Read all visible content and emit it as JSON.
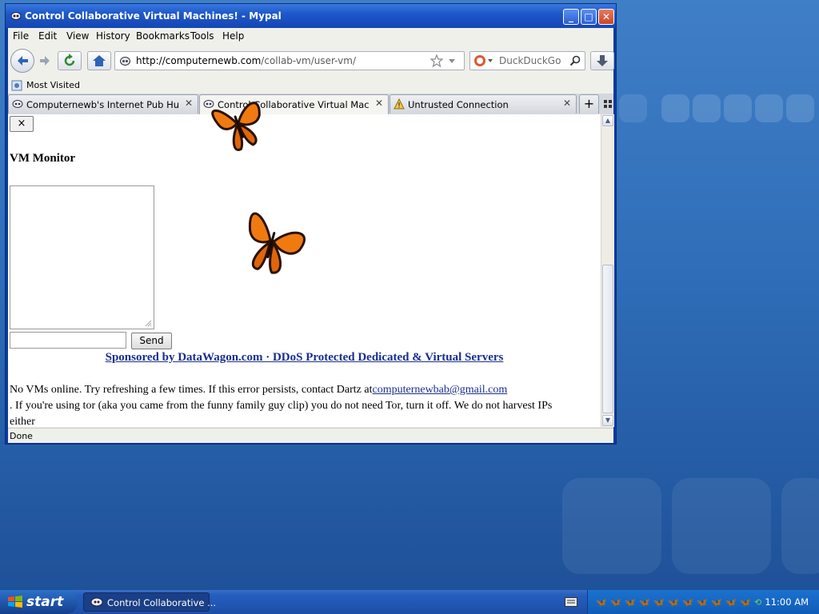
{
  "window": {
    "title": "Control Collaborative Virtual Machines! - Mypal",
    "controls": {
      "minimize": "_",
      "maximize": "□",
      "close": "✕"
    }
  },
  "menu": [
    "File",
    "Edit",
    "View",
    "History",
    "Bookmarks",
    "Tools",
    "Help"
  ],
  "navbar": {
    "url_host": "http://computernewb.com",
    "url_path": "/collab-vm/user-vm/",
    "search_placeholder": "DuckDuckGo"
  },
  "bookmarks": {
    "most_visited": "Most Visited"
  },
  "tabs": [
    {
      "label": "Computernewb's Internet Pub Hub",
      "active": false,
      "icon": "globe-icon"
    },
    {
      "label": "Control Collaborative Virtual Machines!",
      "active": true,
      "icon": "globe-icon"
    },
    {
      "label": "Untrusted Connection",
      "active": false,
      "icon": "warning-icon"
    }
  ],
  "tabstrip": {
    "new_tab": "+"
  },
  "page": {
    "close_label": "×",
    "heading": "VM Monitor",
    "send_label": "Send",
    "sponsor": "Sponsored by DataWagon.com · DDoS Protected Dedicated & Virtual Servers",
    "msg_line1": "No VMs online. Try refreshing a few times. If this error persists, contact Dartz at",
    "msg_email": "computernewbab@gmail.com",
    "msg_line2": ". If you're using tor (aka you came from the funny family guy clip) you do not need Tor, turn it off. We do not harvest IPs",
    "msg_line3": "either"
  },
  "status": {
    "text": "Done"
  },
  "taskbar": {
    "start": "start",
    "item": "Control Collaborative ...",
    "clock": "11:00 AM"
  },
  "colors": {
    "link": "#1a2e8f",
    "title_bar": "#1e58c9",
    "butterfly": "#f07a10"
  }
}
